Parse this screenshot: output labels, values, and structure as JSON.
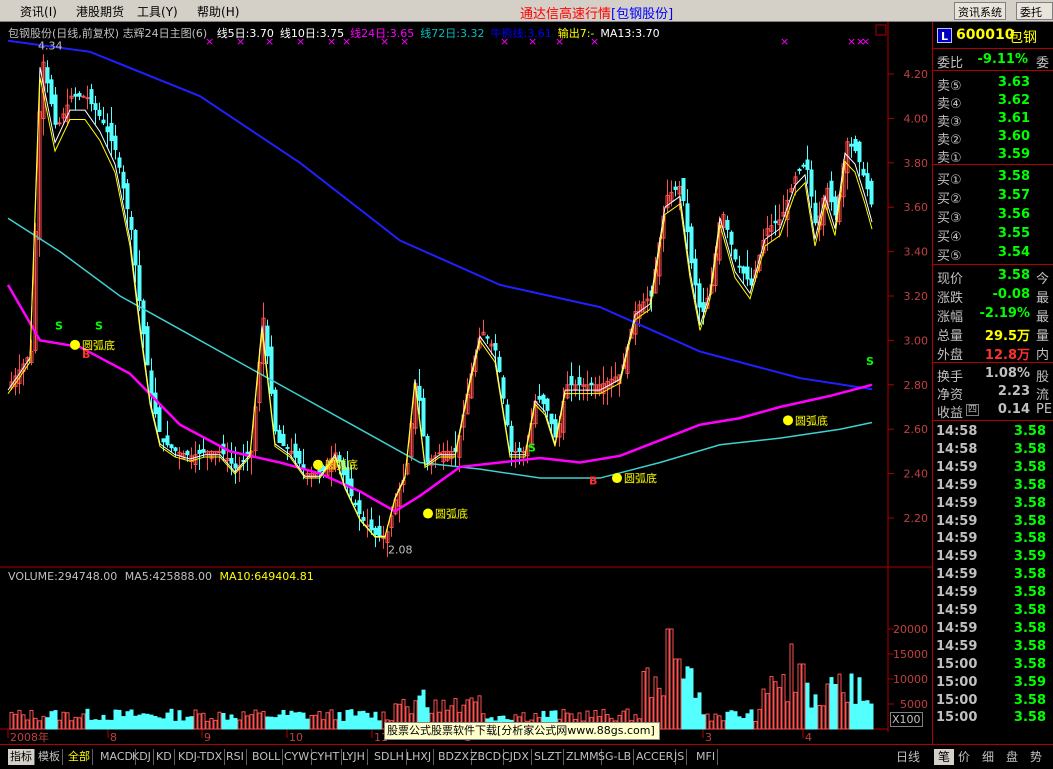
{
  "menu": {
    "items": [
      "资讯",
      "港股期货",
      "工具",
      "帮助"
    ],
    "hotkeys": [
      "(I)",
      "",
      "(Y)",
      "(H)"
    ],
    "title_prefix": "通达信高速行情",
    "title_stock": "[包钢股份]",
    "right_buttons": [
      "资讯系统",
      "委托"
    ]
  },
  "chart_header": {
    "name": "包钢股份(日线,前复权)",
    "indicator": "志辉24日主图(6)",
    "lines": [
      {
        "label": "线5日:3.70",
        "color": "#ffffff"
      },
      {
        "label": "线10日:3.75",
        "color": "#ffffff"
      },
      {
        "label": "线24日:3.65",
        "color": "#ff00ff"
      },
      {
        "label": "线72日:3.32",
        "color": "#00c0c0"
      },
      {
        "label": "牛熊线:3.61",
        "color": "#0000ff"
      },
      {
        "label": "输出7:-",
        "color": "#ffff00"
      },
      {
        "label": "MA13:3.70",
        "color": "#ffffff"
      }
    ]
  },
  "volume_header": {
    "volume": "VOLUME:294748.00",
    "ma5": "MA5:425888.00",
    "ma10": "MA10:649404.81"
  },
  "price_axis": [
    "4.20",
    "4.00",
    "3.80",
    "3.60",
    "3.40",
    "3.20",
    "3.00",
    "2.80",
    "2.60",
    "2.40",
    "2.20"
  ],
  "volume_axis": [
    "20000",
    "15000",
    "10000",
    "5000"
  ],
  "volume_unit": "X100",
  "time_axis": [
    "2008年",
    "8",
    "9",
    "10",
    "11",
    "1",
    "3",
    "4"
  ],
  "annotations": {
    "high": "4.34",
    "low": "2.08",
    "pattern": "圆弧底",
    "buy": "B",
    "sell": "S"
  },
  "ad_text": "股票公式股票软件下载[分析家公式网www.88gs.com]",
  "quote": {
    "code_badge": "L",
    "code": "600010",
    "name": "包钢",
    "weibi_label": "委比",
    "weibi": "-9.11%",
    "weibi_extra": "委",
    "asks": [
      {
        "label": "卖⑤",
        "price": "3.63"
      },
      {
        "label": "卖④",
        "price": "3.62"
      },
      {
        "label": "卖③",
        "price": "3.61"
      },
      {
        "label": "卖②",
        "price": "3.60"
      },
      {
        "label": "卖①",
        "price": "3.59"
      }
    ],
    "bids": [
      {
        "label": "买①",
        "price": "3.58"
      },
      {
        "label": "买②",
        "price": "3.57"
      },
      {
        "label": "买③",
        "price": "3.56"
      },
      {
        "label": "买④",
        "price": "3.55"
      },
      {
        "label": "买⑤",
        "price": "3.54"
      }
    ],
    "stats1": [
      {
        "label": "现价",
        "value": "3.58",
        "extra": "今",
        "color": "#00ff00"
      },
      {
        "label": "涨跌",
        "value": "-0.08",
        "extra": "最",
        "color": "#00ff00"
      },
      {
        "label": "涨幅",
        "value": "-2.19%",
        "extra": "最",
        "color": "#00ff00"
      },
      {
        "label": "总量",
        "value": "29.5万",
        "extra": "量",
        "color": "#ffff00"
      },
      {
        "label": "外盘",
        "value": "12.8万",
        "extra": "内",
        "color": "#ff3030"
      }
    ],
    "stats2": [
      {
        "label": "换手",
        "value": "1.08%",
        "extra": "股",
        "color": "#c0c0c0"
      },
      {
        "label": "净资",
        "value": "2.23",
        "extra": "流",
        "color": "#c0c0c0"
      },
      {
        "label": "收益",
        "value": "0.14",
        "extra": "PE",
        "color": "#c0c0c0",
        "icon": "四"
      }
    ],
    "ticks": [
      {
        "time": "14:58",
        "price": "3.58"
      },
      {
        "time": "14:58",
        "price": "3.58"
      },
      {
        "time": "14:59",
        "price": "3.58"
      },
      {
        "time": "14:59",
        "price": "3.58"
      },
      {
        "time": "14:59",
        "price": "3.58"
      },
      {
        "time": "14:59",
        "price": "3.58"
      },
      {
        "time": "14:59",
        "price": "3.58"
      },
      {
        "time": "14:59",
        "price": "3.59"
      },
      {
        "time": "14:59",
        "price": "3.58"
      },
      {
        "time": "14:59",
        "price": "3.58"
      },
      {
        "time": "14:59",
        "price": "3.58"
      },
      {
        "time": "14:59",
        "price": "3.58"
      },
      {
        "time": "14:59",
        "price": "3.58"
      },
      {
        "time": "15:00",
        "price": "3.58"
      },
      {
        "time": "15:00",
        "price": "3.59"
      },
      {
        "time": "15:00",
        "price": "3.58"
      },
      {
        "time": "15:00",
        "price": "3.58"
      }
    ]
  },
  "tabs": [
    "指标",
    "模板",
    "全部",
    "MACD",
    "KDJ",
    "KD",
    "KDJ-TDX",
    "RSI",
    "BOLL",
    "CYW",
    "CYHT",
    "LYJH",
    "SDLH",
    "LHXJ",
    "BDZX",
    "ZBCD",
    "CJDX",
    "SLZT",
    "ZLMM",
    "SG-LB",
    "ACCER",
    "JS",
    "MFI"
  ],
  "period_label": "日线",
  "right_tabs": [
    "笔",
    "价",
    "细",
    "盘",
    "势"
  ],
  "colors": {
    "up": "#ff5050",
    "down": "#54ffff",
    "bull_bear": "#2020ff",
    "line24": "#ff00ff",
    "line72": "#40d0d0",
    "panel_border": "#b00000"
  }
}
